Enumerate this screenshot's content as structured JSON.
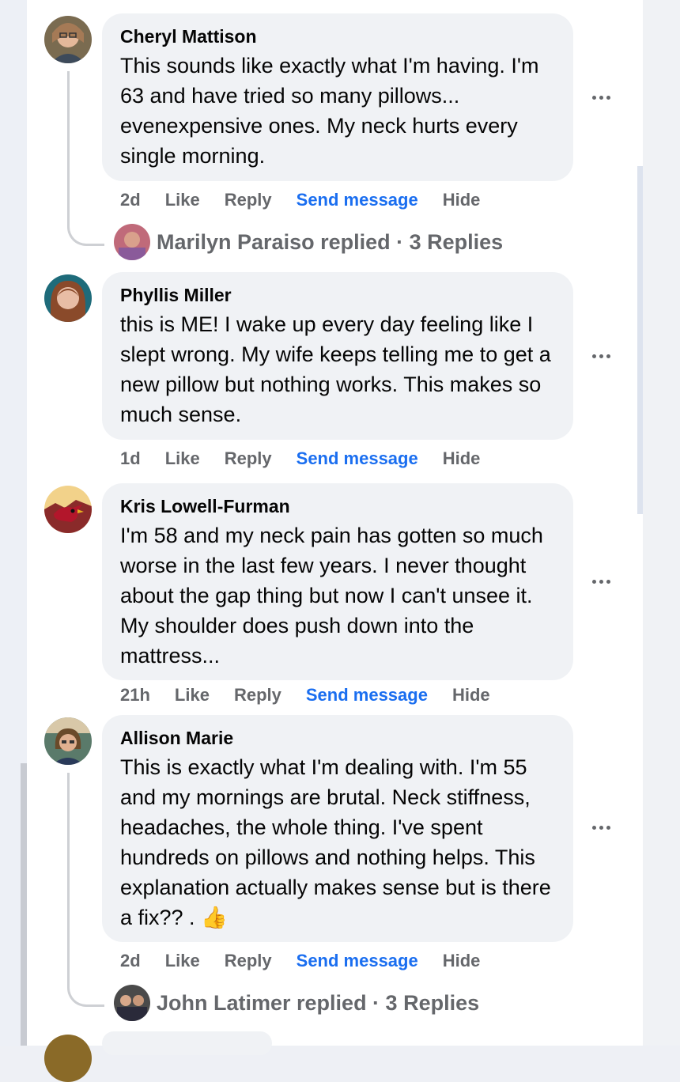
{
  "comments": [
    {
      "author": "Cheryl Mattison",
      "text": "This sounds like exactly what I'm having. I'm 63 and have tried so many pillows... evenexpensive ones. My neck hurts every single morning.",
      "time": "2d",
      "like": "Like",
      "reply": "Reply",
      "send": "Send message",
      "hide": "Hide",
      "replies_summary": "Marilyn Paraiso replied · 3 Replies"
    },
    {
      "author": "Phyllis Miller",
      "text": "this is ME! I wake up every day feeling like I slept wrong. My wife keeps telling me to get a new pillow but nothing works. This makes so much sense.",
      "time": "1d",
      "like": "Like",
      "reply": "Reply",
      "send": "Send message",
      "hide": "Hide"
    },
    {
      "author": "Kris Lowell-Furman",
      "text": "I'm 58 and my neck pain has gotten so much worse in the last few years. I never thought about the gap thing but now I can't unsee it. My shoulder does push down into the mattress...",
      "time": "21h",
      "like": "Like",
      "reply": "Reply",
      "send": "Send message",
      "hide": "Hide"
    },
    {
      "author": "Allison Marie",
      "text": "This is exactly what I'm dealing with. I'm 55 and my mornings are brutal. Neck stiffness, headaches, the whole thing. I've spent hundreds on pillows and nothing helps. This explanation actually makes sense but is there a fix?? . 👍",
      "time": "2d",
      "like": "Like",
      "reply": "Reply",
      "send": "Send message",
      "hide": "Hide",
      "replies_summary": "John Latimer replied · 3 Replies"
    }
  ],
  "colors": {
    "link_blue": "#1a6ef0",
    "meta_gray": "#65676b",
    "bubble_bg": "#f0f2f5"
  }
}
